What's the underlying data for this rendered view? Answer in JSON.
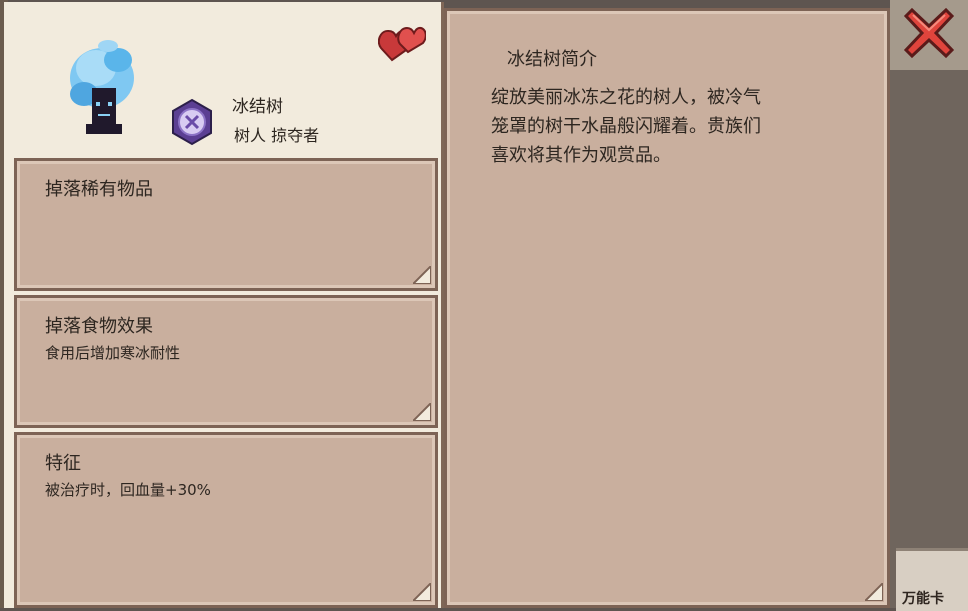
{
  "monster": {
    "name": "冰结树",
    "tags": "树人 掠夺者",
    "sprite_icon": "ice-tree-sprite-icon",
    "badge_icon": "purple-x-badge-icon"
  },
  "favorite": {
    "icon": "heart-icon"
  },
  "close": {
    "icon": "close-x-icon"
  },
  "sections": {
    "rare_drop": {
      "title": "掉落稀有物品",
      "text": ""
    },
    "food_effect": {
      "title": "掉落食物效果",
      "text": "食用后增加寒冰耐性"
    },
    "trait": {
      "title": "特征",
      "text": "被治疗时，回血量+30%"
    }
  },
  "intro": {
    "title": "冰结树简介",
    "lines": [
      "绽放美丽冰冻之花的树人，被冷气",
      "笼罩的树干水晶般闪耀着。贵族们",
      "喜欢将其作为观赏品。"
    ]
  },
  "side": {
    "card_label": "万能卡"
  },
  "colors": {
    "panel_bg": "#c9af9e",
    "panel_border": "#7d6355",
    "header_bg": "#f2ebdd",
    "close_red": "#e0443c",
    "heart_red": "#d64541"
  }
}
